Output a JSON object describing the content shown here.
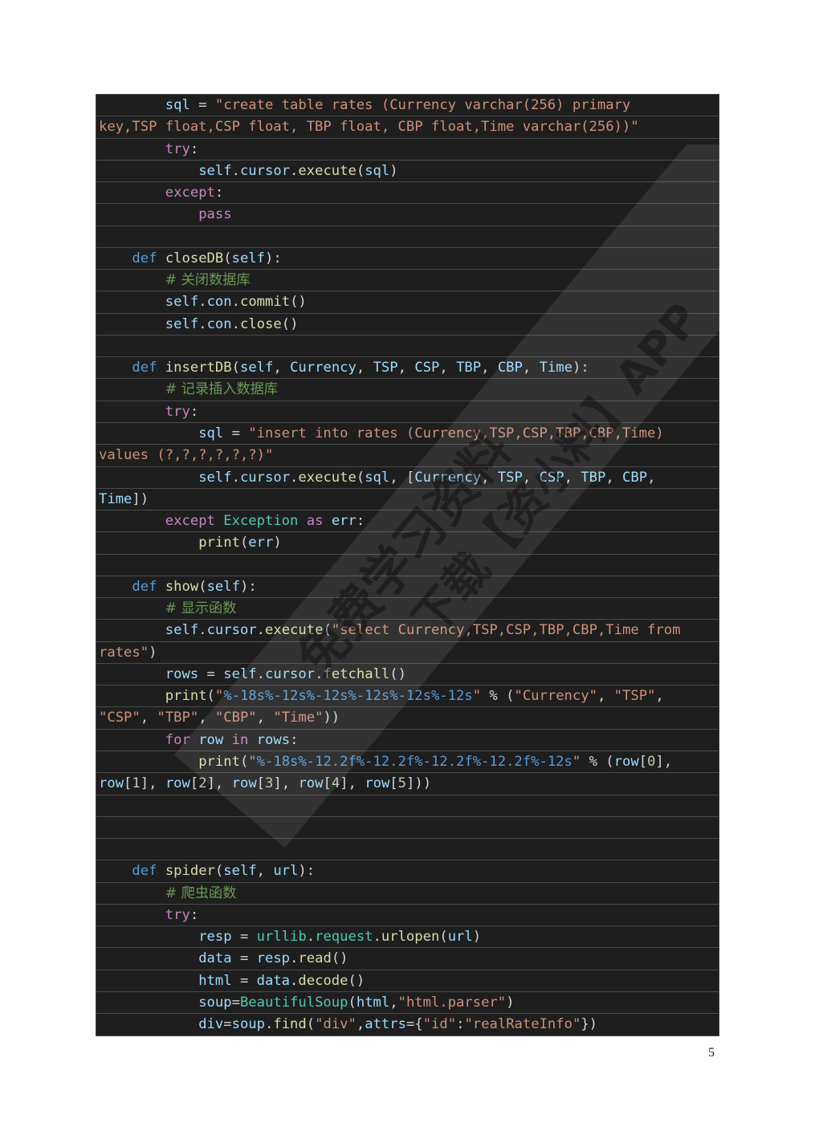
{
  "code": {
    "language": "python",
    "lines": [
      [
        [
          "sp",
          "        "
        ],
        [
          "var",
          "sql"
        ],
        [
          "op",
          " = "
        ],
        [
          "str",
          "\"create table rates (Currency varchar(256) primary"
        ]
      ],
      [
        [
          "str",
          "key,TSP float,CSP float, TBP float, CBP float,Time varchar(256))\""
        ]
      ],
      [
        [
          "sp",
          "        "
        ],
        [
          "kw",
          "try"
        ],
        [
          "op",
          ":"
        ]
      ],
      [
        [
          "sp",
          "            "
        ],
        [
          "var",
          "self"
        ],
        [
          "op",
          "."
        ],
        [
          "var",
          "cursor"
        ],
        [
          "op",
          "."
        ],
        [
          "fn",
          "execute"
        ],
        [
          "op",
          "("
        ],
        [
          "var",
          "sql"
        ],
        [
          "op",
          ")"
        ]
      ],
      [
        [
          "sp",
          "        "
        ],
        [
          "kw",
          "except"
        ],
        [
          "op",
          ":"
        ]
      ],
      [
        [
          "sp",
          "            "
        ],
        [
          "kw",
          "pass"
        ]
      ],
      [],
      [
        [
          "sp",
          "    "
        ],
        [
          "def",
          "def"
        ],
        [
          "op",
          " "
        ],
        [
          "fn",
          "closeDB"
        ],
        [
          "op",
          "("
        ],
        [
          "var",
          "self"
        ],
        [
          "op",
          "):"
        ]
      ],
      [
        [
          "sp",
          "        "
        ],
        [
          "com",
          "# 关闭数据库"
        ]
      ],
      [
        [
          "sp",
          "        "
        ],
        [
          "var",
          "self"
        ],
        [
          "op",
          "."
        ],
        [
          "var",
          "con"
        ],
        [
          "op",
          "."
        ],
        [
          "fn",
          "commit"
        ],
        [
          "op",
          "()"
        ]
      ],
      [
        [
          "sp",
          "        "
        ],
        [
          "var",
          "self"
        ],
        [
          "op",
          "."
        ],
        [
          "var",
          "con"
        ],
        [
          "op",
          "."
        ],
        [
          "fn",
          "close"
        ],
        [
          "op",
          "()"
        ]
      ],
      [],
      [
        [
          "sp",
          "    "
        ],
        [
          "def",
          "def"
        ],
        [
          "op",
          " "
        ],
        [
          "fn",
          "insertDB"
        ],
        [
          "op",
          "("
        ],
        [
          "var",
          "self"
        ],
        [
          "op",
          ", "
        ],
        [
          "var",
          "Currency"
        ],
        [
          "op",
          ", "
        ],
        [
          "var",
          "TSP"
        ],
        [
          "op",
          ", "
        ],
        [
          "var",
          "CSP"
        ],
        [
          "op",
          ", "
        ],
        [
          "var",
          "TBP"
        ],
        [
          "op",
          ", "
        ],
        [
          "var",
          "CBP"
        ],
        [
          "op",
          ", "
        ],
        [
          "var",
          "Time"
        ],
        [
          "op",
          "):"
        ]
      ],
      [
        [
          "sp",
          "        "
        ],
        [
          "com",
          "# 记录插入数据库"
        ]
      ],
      [
        [
          "sp",
          "        "
        ],
        [
          "kw",
          "try"
        ],
        [
          "op",
          ":"
        ]
      ],
      [
        [
          "sp",
          "            "
        ],
        [
          "var",
          "sql"
        ],
        [
          "op",
          " = "
        ],
        [
          "str",
          "\"insert into rates (Currency,TSP,CSP,TBP,CBP,Time)"
        ]
      ],
      [
        [
          "str",
          "values (?,?,?,?,?,?)\""
        ]
      ],
      [
        [
          "sp",
          "            "
        ],
        [
          "var",
          "self"
        ],
        [
          "op",
          "."
        ],
        [
          "var",
          "cursor"
        ],
        [
          "op",
          "."
        ],
        [
          "fn",
          "execute"
        ],
        [
          "op",
          "("
        ],
        [
          "var",
          "sql"
        ],
        [
          "op",
          ", ["
        ],
        [
          "var",
          "Currency"
        ],
        [
          "op",
          ", "
        ],
        [
          "var",
          "TSP"
        ],
        [
          "op",
          ", "
        ],
        [
          "var",
          "CSP"
        ],
        [
          "op",
          ", "
        ],
        [
          "var",
          "TBP"
        ],
        [
          "op",
          ", "
        ],
        [
          "var",
          "CBP"
        ],
        [
          "op",
          ","
        ]
      ],
      [
        [
          "var",
          "Time"
        ],
        [
          "op",
          "])"
        ]
      ],
      [
        [
          "sp",
          "        "
        ],
        [
          "kw",
          "except"
        ],
        [
          "op",
          " "
        ],
        [
          "cls",
          "Exception"
        ],
        [
          "op",
          " "
        ],
        [
          "kw",
          "as"
        ],
        [
          "op",
          " "
        ],
        [
          "var",
          "err"
        ],
        [
          "op",
          ":"
        ]
      ],
      [
        [
          "sp",
          "            "
        ],
        [
          "fn",
          "print"
        ],
        [
          "op",
          "("
        ],
        [
          "var",
          "err"
        ],
        [
          "op",
          ")"
        ]
      ],
      [],
      [
        [
          "sp",
          "    "
        ],
        [
          "def",
          "def"
        ],
        [
          "op",
          " "
        ],
        [
          "fn",
          "show"
        ],
        [
          "op",
          "("
        ],
        [
          "var",
          "self"
        ],
        [
          "op",
          "):"
        ]
      ],
      [
        [
          "sp",
          "        "
        ],
        [
          "com",
          "# 显示函数"
        ]
      ],
      [
        [
          "sp",
          "        "
        ],
        [
          "var",
          "self"
        ],
        [
          "op",
          "."
        ],
        [
          "var",
          "cursor"
        ],
        [
          "op",
          "."
        ],
        [
          "fn",
          "execute"
        ],
        [
          "op",
          "("
        ],
        [
          "str",
          "\"select Currency,TSP,CSP,TBP,CBP,Time from"
        ]
      ],
      [
        [
          "str",
          "rates\""
        ],
        [
          "op",
          ")"
        ]
      ],
      [
        [
          "sp",
          "        "
        ],
        [
          "var",
          "rows"
        ],
        [
          "op",
          " = "
        ],
        [
          "var",
          "self"
        ],
        [
          "op",
          "."
        ],
        [
          "var",
          "cursor"
        ],
        [
          "op",
          "."
        ],
        [
          "fn",
          "fetchall"
        ],
        [
          "op",
          "()"
        ]
      ],
      [
        [
          "sp",
          "        "
        ],
        [
          "fn",
          "print"
        ],
        [
          "op",
          "("
        ],
        [
          "str",
          "\""
        ],
        [
          "fmt",
          "%-18s%-12s%-12s%-12s%-12s%-12s"
        ],
        [
          "str",
          "\""
        ],
        [
          "op",
          " % ("
        ],
        [
          "str",
          "\"Currency\""
        ],
        [
          "op",
          ", "
        ],
        [
          "str",
          "\"TSP\""
        ],
        [
          "op",
          ","
        ]
      ],
      [
        [
          "str",
          "\"CSP\""
        ],
        [
          "op",
          ", "
        ],
        [
          "str",
          "\"TBP\""
        ],
        [
          "op",
          ", "
        ],
        [
          "str",
          "\"CBP\""
        ],
        [
          "op",
          ", "
        ],
        [
          "str",
          "\"Time\""
        ],
        [
          "op",
          "))"
        ]
      ],
      [
        [
          "sp",
          "        "
        ],
        [
          "kw",
          "for"
        ],
        [
          "op",
          " "
        ],
        [
          "var",
          "row"
        ],
        [
          "op",
          " "
        ],
        [
          "kw",
          "in"
        ],
        [
          "op",
          " "
        ],
        [
          "var",
          "rows"
        ],
        [
          "op",
          ":"
        ]
      ],
      [
        [
          "sp",
          "            "
        ],
        [
          "fn",
          "print"
        ],
        [
          "op",
          "("
        ],
        [
          "str",
          "\""
        ],
        [
          "fmt",
          "%-18s%-12.2f%-12.2f%-12.2f%-12.2f%-12s"
        ],
        [
          "str",
          "\""
        ],
        [
          "op",
          " % ("
        ],
        [
          "var",
          "row"
        ],
        [
          "op",
          "["
        ],
        [
          "num",
          "0"
        ],
        [
          "op",
          "],"
        ]
      ],
      [
        [
          "var",
          "row"
        ],
        [
          "op",
          "["
        ],
        [
          "num",
          "1"
        ],
        [
          "op",
          "], "
        ],
        [
          "var",
          "row"
        ],
        [
          "op",
          "["
        ],
        [
          "num",
          "2"
        ],
        [
          "op",
          "], "
        ],
        [
          "var",
          "row"
        ],
        [
          "op",
          "["
        ],
        [
          "num",
          "3"
        ],
        [
          "op",
          "], "
        ],
        [
          "var",
          "row"
        ],
        [
          "op",
          "["
        ],
        [
          "num",
          "4"
        ],
        [
          "op",
          "], "
        ],
        [
          "var",
          "row"
        ],
        [
          "op",
          "["
        ],
        [
          "num",
          "5"
        ],
        [
          "op",
          "]))"
        ]
      ],
      [],
      [],
      [],
      [
        [
          "sp",
          "    "
        ],
        [
          "def",
          "def"
        ],
        [
          "op",
          " "
        ],
        [
          "fn",
          "spider"
        ],
        [
          "op",
          "("
        ],
        [
          "var",
          "self"
        ],
        [
          "op",
          ", "
        ],
        [
          "var",
          "url"
        ],
        [
          "op",
          "):"
        ]
      ],
      [
        [
          "sp",
          "        "
        ],
        [
          "com",
          "# 爬虫函数"
        ]
      ],
      [
        [
          "sp",
          "        "
        ],
        [
          "kw",
          "try"
        ],
        [
          "op",
          ":"
        ]
      ],
      [
        [
          "sp",
          "            "
        ],
        [
          "var",
          "resp"
        ],
        [
          "op",
          " = "
        ],
        [
          "cls",
          "urllib"
        ],
        [
          "op",
          "."
        ],
        [
          "cls",
          "request"
        ],
        [
          "op",
          "."
        ],
        [
          "fn",
          "urlopen"
        ],
        [
          "op",
          "("
        ],
        [
          "var",
          "url"
        ],
        [
          "op",
          ")"
        ]
      ],
      [
        [
          "sp",
          "            "
        ],
        [
          "var",
          "data"
        ],
        [
          "op",
          " = "
        ],
        [
          "var",
          "resp"
        ],
        [
          "op",
          "."
        ],
        [
          "fn",
          "read"
        ],
        [
          "op",
          "()"
        ]
      ],
      [
        [
          "sp",
          "            "
        ],
        [
          "var",
          "html"
        ],
        [
          "op",
          " = "
        ],
        [
          "var",
          "data"
        ],
        [
          "op",
          "."
        ],
        [
          "fn",
          "decode"
        ],
        [
          "op",
          "()"
        ]
      ],
      [
        [
          "sp",
          "            "
        ],
        [
          "var",
          "soup"
        ],
        [
          "op",
          "="
        ],
        [
          "cls",
          "BeautifulSoup"
        ],
        [
          "op",
          "("
        ],
        [
          "var",
          "html"
        ],
        [
          "op",
          ","
        ],
        [
          "str",
          "\"html.parser\""
        ],
        [
          "op",
          ")"
        ]
      ],
      [
        [
          "sp",
          "            "
        ],
        [
          "var",
          "div"
        ],
        [
          "op",
          "="
        ],
        [
          "var",
          "soup"
        ],
        [
          "op",
          "."
        ],
        [
          "fn",
          "find"
        ],
        [
          "op",
          "("
        ],
        [
          "str",
          "\"div\""
        ],
        [
          "op",
          ","
        ],
        [
          "var",
          "attrs"
        ],
        [
          "op",
          "={"
        ],
        [
          "str",
          "\"id\""
        ],
        [
          "op",
          ":"
        ],
        [
          "str",
          "\"realRateInfo\""
        ],
        [
          "op",
          "})"
        ]
      ]
    ]
  },
  "watermark": {
    "line1": "免费学习资料",
    "line2": "下载【资小料】APP"
  },
  "page": {
    "number": "5"
  }
}
